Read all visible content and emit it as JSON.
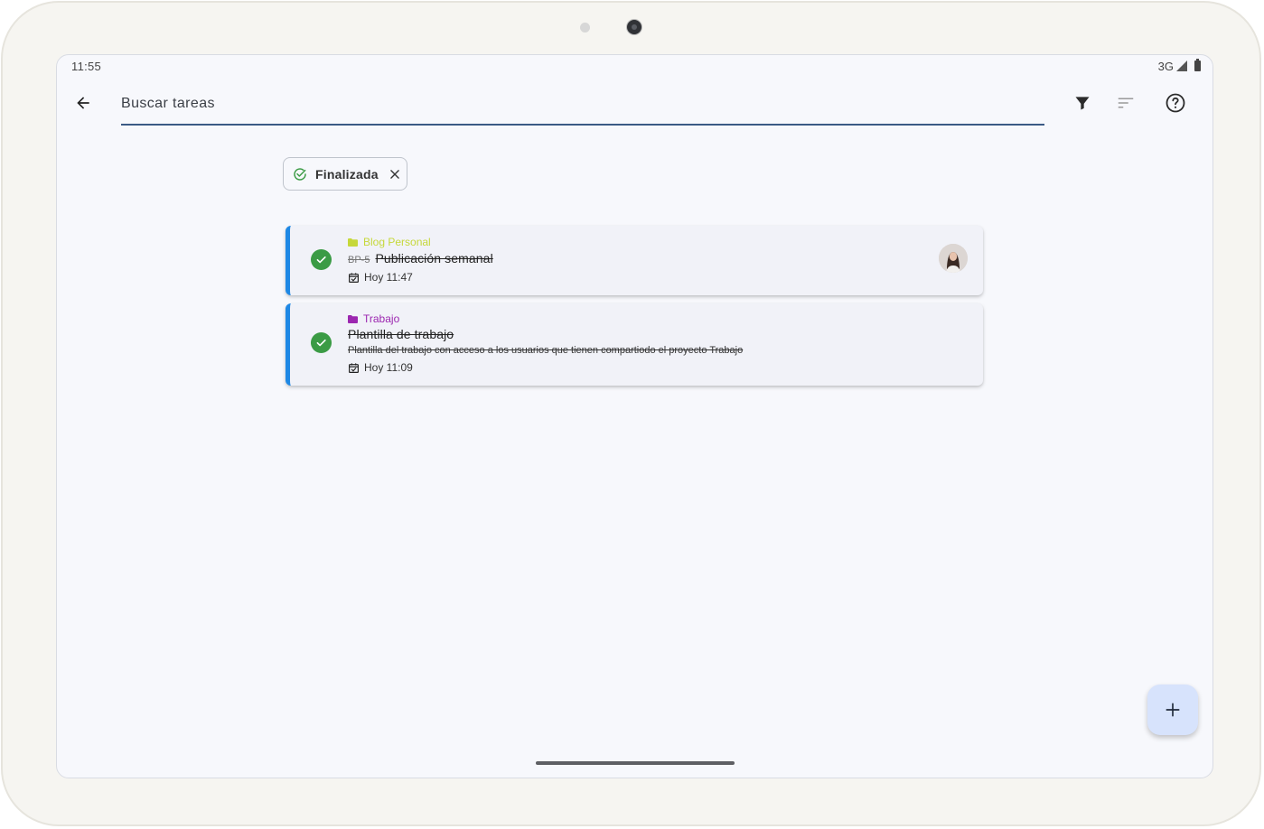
{
  "status_bar": {
    "time": "11:55",
    "network": "3G"
  },
  "search": {
    "placeholder": "Buscar tareas"
  },
  "filter_chip": {
    "label": "Finalizada"
  },
  "tasks": [
    {
      "project": "Blog Personal",
      "project_color": "#c6d83a",
      "code": "BP-5",
      "title": "Publicación semanal",
      "description": "",
      "date": "Hoy 11:47",
      "completed": true,
      "has_avatar": true
    },
    {
      "project": "Trabajo",
      "project_color": "#9c27b0",
      "code": "",
      "title": "Plantilla de trabajo",
      "description": "Plantilla del trabajo con acceso a los usuarios que tienen compartiodo el proyecto Trabajo",
      "date": "Hoy 11:09",
      "completed": true,
      "has_avatar": false
    }
  ],
  "colors": {
    "accent_border": "#1e88e5",
    "completed_green": "#3b9b45",
    "search_underline": "#3b5a85",
    "fab_background": "#d7e3fc"
  },
  "icons": {
    "back": "arrow-left-icon",
    "filter": "filter-funnel-icon",
    "sort": "sort-lines-icon",
    "help": "help-circle-icon",
    "chip_check": "check-circle-icon",
    "chip_close": "close-icon",
    "folder": "folder-icon",
    "calendar": "calendar-check-icon",
    "fab": "plus-icon"
  }
}
